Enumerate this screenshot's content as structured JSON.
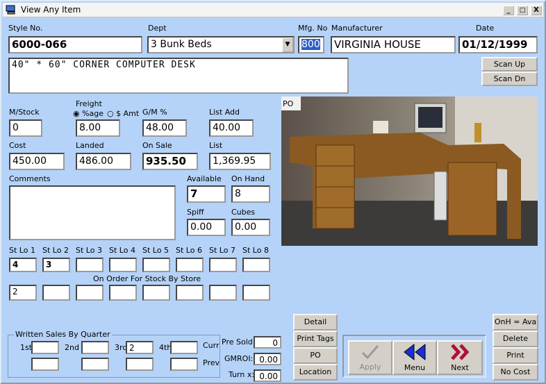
{
  "window": {
    "title": "View Any Item",
    "min": "_",
    "max": "□",
    "close": "X"
  },
  "labels": {
    "style": "Style No.",
    "dept": "Dept",
    "mfg": "Mfg. No",
    "manufacturer": "Manufacturer",
    "date": "Date",
    "mstock": "M/Stock",
    "freight": "Freight",
    "pct": "%age",
    "amt": "$ Amt",
    "gm": "G/M %",
    "list_add": "List Add",
    "cost": "Cost",
    "landed": "Landed",
    "on_sale": "On Sale",
    "list": "List",
    "comments": "Comments",
    "available": "Available",
    "on_hand": "On Hand",
    "spiff": "Spiff",
    "cubes": "Cubes",
    "on_order": "On Order For Stock By Store",
    "written": "Written Sales By Quarter",
    "q1": "1st",
    "q2": "2nd",
    "q3": "3rd",
    "q4": "4th",
    "curr": "Curr",
    "prev": "Prev",
    "pre_sold": "Pre Sold:",
    "gmroi": "GMROI:",
    "turn": "Turn x:"
  },
  "values": {
    "style": "6000-066",
    "dept": "3  Bunk Beds",
    "mfg": "800",
    "manufacturer": "VIRGINIA HOUSE",
    "date": "01/12/1999",
    "description": "40\" * 60\" CORNER COMPUTER DESK",
    "mstock": "0",
    "freight": "8.00",
    "gm": "48.00",
    "list_add": "40.00",
    "cost": "450.00",
    "landed": "486.00",
    "on_sale": "935.50",
    "list": "1,369.95",
    "available": "7",
    "on_hand": "8",
    "spiff": "0.00",
    "cubes": "0.00",
    "q3": "2",
    "pre_sold": "0",
    "gmroi": "0.00",
    "turn": "0.00"
  },
  "stores": {
    "labels": [
      "St Lo 1",
      "St Lo 2",
      "St Lo 3",
      "St Lo 4",
      "St Lo 5",
      "St Lo 6",
      "St Lo 7",
      "St Lo 8"
    ],
    "stock": [
      "4",
      "3",
      "",
      "",
      "",
      "",
      "",
      ""
    ],
    "on_order": [
      "2",
      "",
      "",
      "",
      "",
      "",
      "",
      ""
    ]
  },
  "buttons": {
    "scan_up": "Scan Up",
    "scan_dn": "Scan Dn",
    "detail": "Detail",
    "print_tags": "Print Tags",
    "po": "PO",
    "location": "Location",
    "apply": "Apply",
    "menu": "Menu",
    "next": "Next",
    "onh_ava": "OnH = Ava",
    "delete": "Delete",
    "print": "Print",
    "no_cost": "No Cost"
  },
  "colors": {
    "bg": "#b5d3f8",
    "menu_arrow": "#1b2fd6",
    "next_arrow": "#b0103a"
  }
}
